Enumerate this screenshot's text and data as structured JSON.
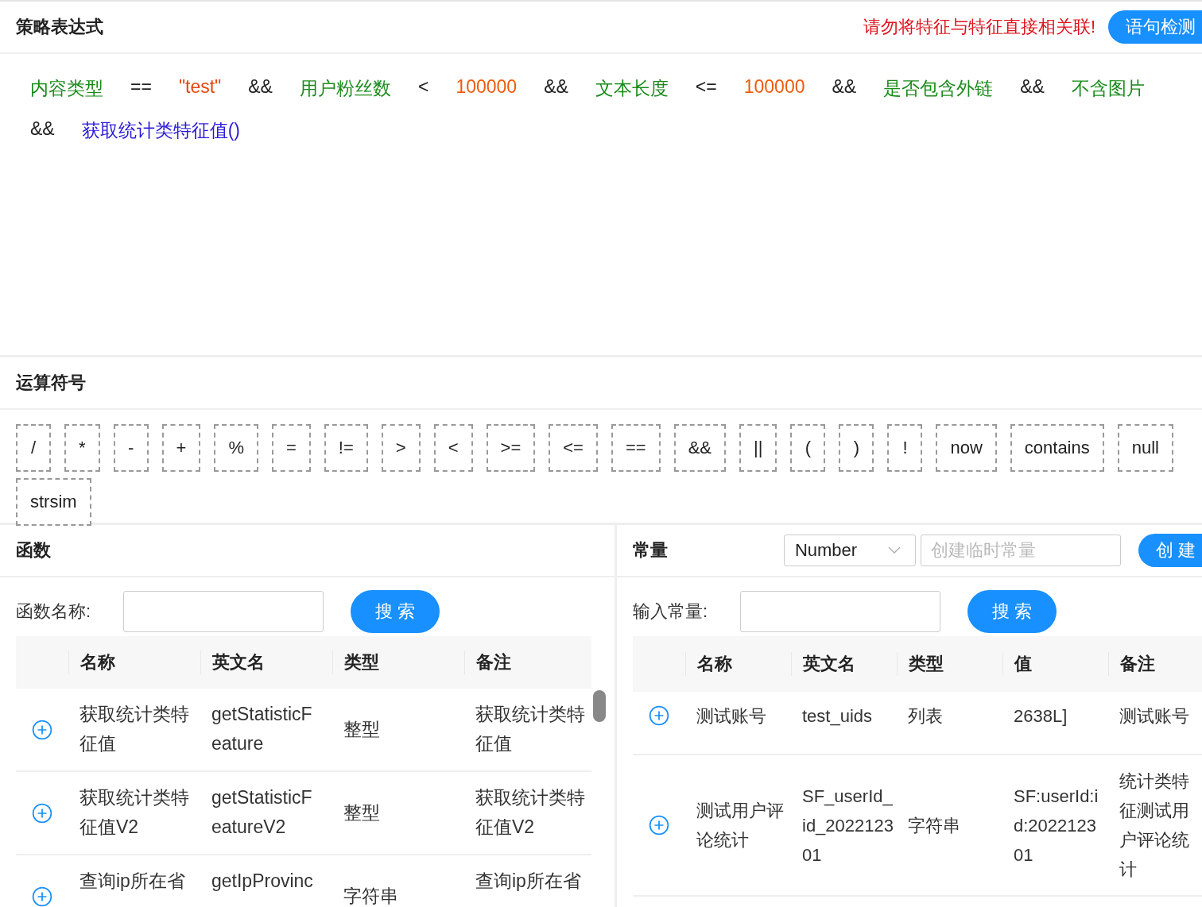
{
  "expression": {
    "title": "策略表达式",
    "warning": "请勿将特征与特征直接相关联!",
    "check_button": "语句检测",
    "tokens": [
      {
        "kind": "feature",
        "text": "内容类型"
      },
      {
        "kind": "operator",
        "text": "=="
      },
      {
        "kind": "string",
        "text": "\"test\""
      },
      {
        "kind": "operator",
        "text": "&&"
      },
      {
        "kind": "feature",
        "text": "用户粉丝数"
      },
      {
        "kind": "operator",
        "text": "<"
      },
      {
        "kind": "number",
        "text": "100000"
      },
      {
        "kind": "operator",
        "text": "&&"
      },
      {
        "kind": "feature",
        "text": "文本长度"
      },
      {
        "kind": "operator",
        "text": "<="
      },
      {
        "kind": "number",
        "text": "100000"
      },
      {
        "kind": "operator",
        "text": "&&"
      },
      {
        "kind": "feature",
        "text": "是否包含外链"
      },
      {
        "kind": "operator",
        "text": "&&"
      },
      {
        "kind": "feature",
        "text": "不含图片"
      },
      {
        "kind": "operator",
        "text": "&&"
      },
      {
        "kind": "function",
        "text": "获取统计类特征值()"
      }
    ]
  },
  "operators": {
    "title": "运算符号",
    "items": [
      "/",
      "*",
      "-",
      "+",
      "%",
      "=",
      "!=",
      ">",
      "<",
      ">=",
      "<=",
      "==",
      "&&",
      "||",
      "(",
      ")",
      "!",
      "now",
      "contains",
      "null",
      "strsim"
    ]
  },
  "functions": {
    "title": "函数",
    "search_label": "函数名称:",
    "search_button": "搜 索",
    "columns": [
      "名称",
      "英文名",
      "类型",
      "备注"
    ],
    "rows": [
      [
        "获取统计类特征值",
        "getStatisticFeature",
        "整型",
        "获取统计类特征值"
      ],
      [
        "获取统计类特征值V2",
        "getStatisticFeatureV2",
        "整型",
        "获取统计类特征值V2"
      ],
      [
        "查询ip所在省",
        "getIpProvinc",
        "字符串",
        "查询ip所在省"
      ]
    ]
  },
  "constants": {
    "title": "常量",
    "type_select": "Number",
    "create_placeholder": "创建临时常量",
    "create_button": "创 建",
    "search_label": "输入常量:",
    "search_button": "搜 索",
    "columns": [
      "名称",
      "英文名",
      "类型",
      "值",
      "备注"
    ],
    "rows": [
      [
        "测试账号",
        "test_uids",
        "列表",
        "2638L]",
        "测试账号"
      ],
      [
        "测试用户评论统计",
        "SF_userId_id_202212301",
        "字符串",
        "SF:userId:id:202212301",
        "统计类特征测试用户评论统计"
      ]
    ]
  }
}
